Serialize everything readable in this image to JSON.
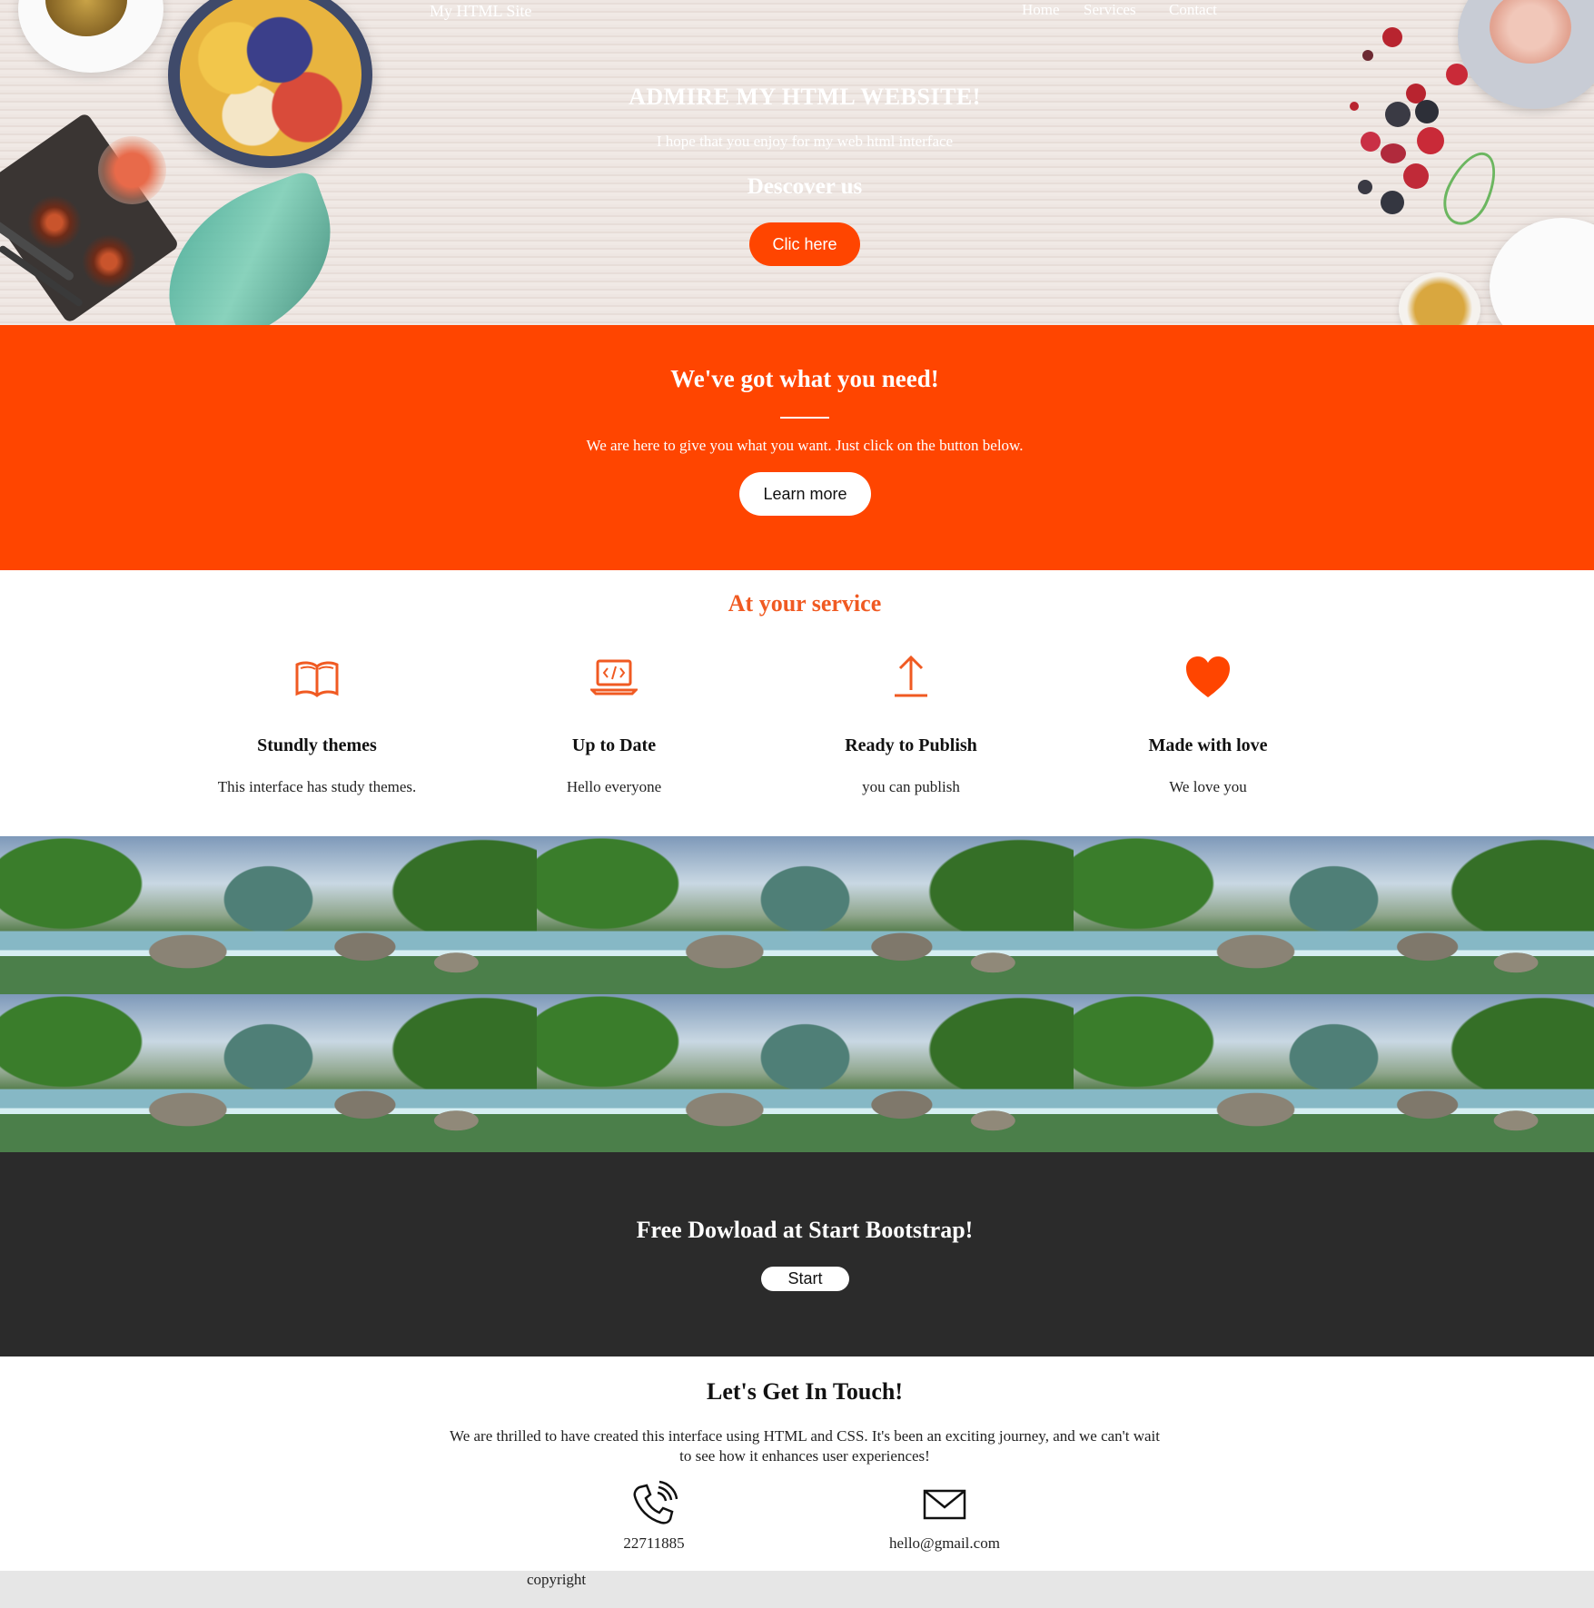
{
  "nav": {
    "brand": "My HTML Site",
    "links": [
      "Home",
      "Services",
      "Contact"
    ]
  },
  "hero": {
    "title": "ADMIRE MY HTML WEBSITE!",
    "subtitle": "I hope that you enjoy for my web html interface",
    "discover": "Descover us",
    "button_label": "Clic here"
  },
  "need": {
    "title": "We've got what you need!",
    "text": "We are here to give you what you want. Just click on the button below.",
    "button_label": "Learn more"
  },
  "services": {
    "title": "At your service",
    "items": [
      {
        "icon": "book-icon",
        "title": "Stundly themes",
        "text": "This interface has study themes."
      },
      {
        "icon": "laptop-code-icon",
        "title": "Up to Date",
        "text": "Hello everyone"
      },
      {
        "icon": "upload-arrow-icon",
        "title": "Ready to Publish",
        "text": "you can publish"
      },
      {
        "icon": "heart-icon",
        "title": "Made with love",
        "text": "We love you"
      }
    ]
  },
  "download": {
    "title": "Free Dowload at Start Bootstrap!",
    "button_label": "Start"
  },
  "contact": {
    "title": "Let's Get In Touch!",
    "text": "We are thrilled to have created this interface using HTML and CSS. It's been an exciting journey, and we can't wait to see how it enhances user experiences!",
    "phone": "22711885",
    "email": "hello@gmail.com"
  },
  "footer": {
    "text": "copyright"
  },
  "colors": {
    "accent": "#ff4500",
    "dark": "#2b2b2b",
    "footer": "#e6e6e6"
  }
}
